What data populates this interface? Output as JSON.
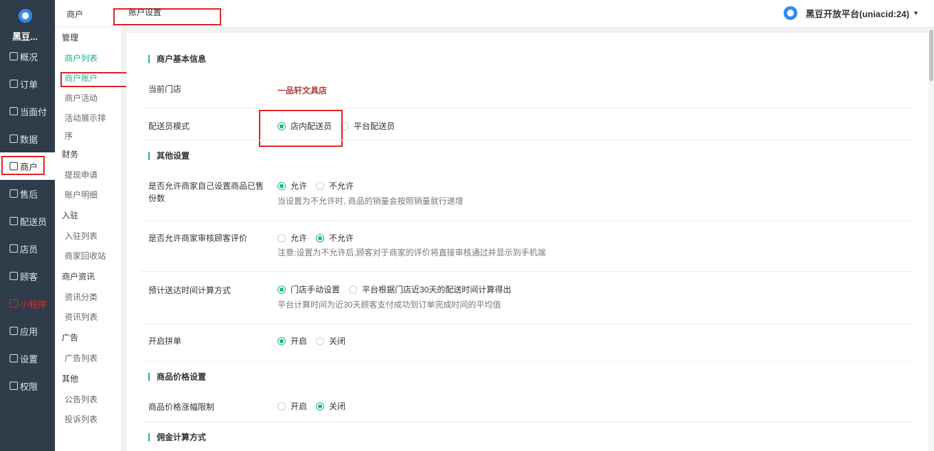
{
  "sidebar": {
    "brand_name": "黑豆...",
    "items": [
      {
        "label": "概况"
      },
      {
        "label": "订单"
      },
      {
        "label": "当面付"
      },
      {
        "label": "数据"
      },
      {
        "label": "商户"
      },
      {
        "label": "售后"
      },
      {
        "label": "配送员"
      },
      {
        "label": "店员"
      },
      {
        "label": "顾客"
      },
      {
        "label": "小程序"
      },
      {
        "label": "应用"
      },
      {
        "label": "设置"
      },
      {
        "label": "权限"
      }
    ]
  },
  "submenu": {
    "groups": [
      {
        "title": "管理",
        "items": [
          "商户列表",
          "商户账户",
          "商户活动",
          "活动展示排",
          "序"
        ]
      },
      {
        "title": "财务",
        "items": [
          "提现申请",
          "账户明细"
        ]
      },
      {
        "title": "入驻",
        "items": [
          "入驻列表",
          "商家回收站"
        ]
      },
      {
        "title": "商户资讯",
        "items": [
          "资讯分类",
          "资讯列表"
        ]
      },
      {
        "title": "广告",
        "items": [
          "广告列表"
        ]
      },
      {
        "title": "其他",
        "items": [
          "公告列表",
          "投诉列表"
        ]
      }
    ]
  },
  "header": {
    "breadcrumb_main": "商户",
    "breadcrumb_current": "账户设置",
    "platform_name": "黑豆开放平台(uniacid:24)"
  },
  "form": {
    "section_basic": "商户基本信息",
    "current_store_label": "当前门店",
    "current_store_value": "一品轩文具店",
    "delivery_mode_label": "配送员模式",
    "delivery_mode_options": [
      "店内配送员",
      "平台配送员"
    ],
    "section_other": "其他设置",
    "allow_sales_label": "是否允许商家自己设置商品已售份数",
    "allow_sales_options": [
      "允许",
      "不允许"
    ],
    "allow_sales_help": "当设置为不允许时, 商品的销量会按照销量就行递增",
    "allow_review_label": "是否允许商家审核顾客评价",
    "allow_review_options": [
      "允许",
      "不允许"
    ],
    "allow_review_help": "注意:设置为不允许后,顾客对于商家的评价将直接审核通过并显示到手机端",
    "eta_label": "预计送达时间计算方式",
    "eta_options": [
      "门店手动设置",
      "平台根据门店近30天的配送时间计算得出"
    ],
    "eta_help": "平台计算时间为近30天顾客支付成功到订单完成时间的平均值",
    "group_buy_label": "开启拼单",
    "group_buy_options": [
      "开启",
      "关闭"
    ],
    "section_price": "商品价格设置",
    "price_limit_label": "商品价格涨幅限制",
    "price_limit_options": [
      "开启",
      "关闭"
    ],
    "section_commission": "佣金计算方式"
  },
  "state": {
    "delivery_mode": 0,
    "allow_sales": 0,
    "allow_review": 1,
    "eta": 0,
    "group_buy": 0,
    "price_limit": 1
  },
  "colors": {
    "sidebar_bg": "#2f3d4a",
    "accent": "#1ab394",
    "highlight": "#e02020",
    "store_name": "#b33939"
  }
}
